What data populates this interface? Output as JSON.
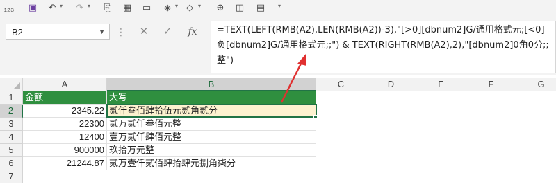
{
  "namebox": {
    "value": "B2"
  },
  "formula": {
    "text": "=TEXT(LEFT(RMB(A2),LEN(RMB(A2))-3),\"[>0][dbnum2]G/通用格式元;[<0]负[dbnum2]G/通用格式元;;\") & TEXT(RIGHT(RMB(A2),2),\"[dbnum2]0角0分;;整\")"
  },
  "fx_label": "fx",
  "columns": [
    "A",
    "B",
    "C",
    "D",
    "E",
    "F",
    "G"
  ],
  "rows": [
    "1",
    "2",
    "3",
    "4",
    "5",
    "6",
    "7"
  ],
  "table": {
    "header": {
      "a": "金额",
      "b": "大写"
    },
    "data": [
      {
        "a": "2345.22",
        "b": "贰仟叁佰肆拾伍元贰角贰分"
      },
      {
        "a": "22300",
        "b": "贰万贰仟叁佰元整"
      },
      {
        "a": "12400",
        "b": "壹万贰仟肆佰元整"
      },
      {
        "a": "900000",
        "b": "玖拾万元整"
      },
      {
        "a": "21244.87",
        "b": "贰万壹仟贰佰肆拾肆元捌角柒分"
      }
    ]
  },
  "colors": {
    "header_green": "#2f8f3f",
    "selection": "#217346",
    "arrow": "#e03030"
  }
}
